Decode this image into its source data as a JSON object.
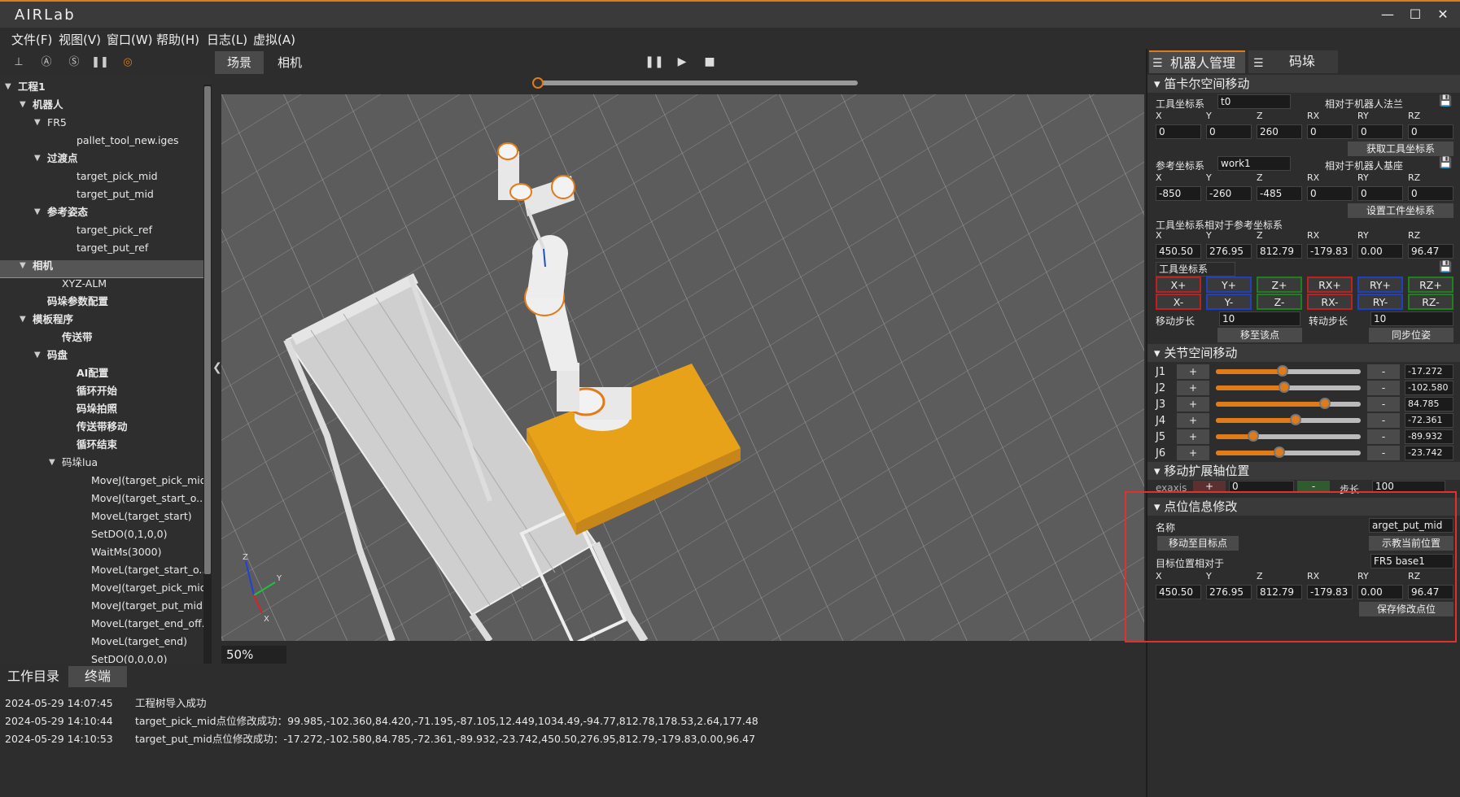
{
  "app": {
    "title": "AIRLab"
  },
  "menu": [
    "文件(F)",
    "视图(V)",
    "窗口(W)",
    "帮助(H)",
    "日志(L)",
    "虚拟(A)"
  ],
  "toolbar_icons": [
    "axis-icon",
    "a-circle-icon",
    "s-circle-icon",
    "pause-bars-icon",
    "target-icon"
  ],
  "view_tabs": [
    "场景",
    "相机"
  ],
  "zoom": "50%",
  "tree": [
    {
      "label": "工程1",
      "bold": true,
      "level": 0,
      "expanded": true
    },
    {
      "label": "机器人",
      "bold": true,
      "level": 1,
      "expanded": true
    },
    {
      "label": "FR5",
      "bold": false,
      "level": 2,
      "expanded": true
    },
    {
      "label": "pallet_tool_new.iges",
      "bold": false,
      "level": 4
    },
    {
      "label": "过渡点",
      "bold": true,
      "level": 2,
      "expanded": true
    },
    {
      "label": "target_pick_mid",
      "bold": false,
      "level": 4
    },
    {
      "label": "target_put_mid",
      "bold": false,
      "level": 4,
      "selected": true
    },
    {
      "label": "参考姿态",
      "bold": true,
      "level": 2,
      "expanded": true
    },
    {
      "label": "target_pick_ref",
      "bold": false,
      "level": 4
    },
    {
      "label": "target_put_ref",
      "bold": false,
      "level": 4
    },
    {
      "label": "相机",
      "bold": true,
      "level": 1,
      "expanded": true
    },
    {
      "label": "XYZ-ALM",
      "bold": false,
      "level": 3
    },
    {
      "label": "码垛参数配置",
      "bold": true,
      "level": 2
    },
    {
      "label": "模板程序",
      "bold": true,
      "level": 1,
      "expanded": true
    },
    {
      "label": "传送带",
      "bold": true,
      "level": 3
    },
    {
      "label": "码盘",
      "bold": true,
      "level": 2,
      "expanded": true
    },
    {
      "label": "AI配置",
      "bold": true,
      "level": 4
    },
    {
      "label": "循环开始",
      "bold": true,
      "level": 4
    },
    {
      "label": "码垛拍照",
      "bold": true,
      "level": 4
    },
    {
      "label": "传送带移动",
      "bold": true,
      "level": 4
    },
    {
      "label": "循环结束",
      "bold": true,
      "level": 4
    },
    {
      "label": "码垛lua",
      "bold": false,
      "level": 3,
      "expanded": true
    },
    {
      "label": "MoveJ(target_pick_mid)",
      "bold": false,
      "level": 5
    },
    {
      "label": "MoveJ(target_start_o...",
      "bold": false,
      "level": 5
    },
    {
      "label": "MoveL(target_start)",
      "bold": false,
      "level": 5
    },
    {
      "label": "SetDO(0,1,0,0)",
      "bold": false,
      "level": 5
    },
    {
      "label": "WaitMs(3000)",
      "bold": false,
      "level": 5
    },
    {
      "label": "MoveL(target_start_o...",
      "bold": false,
      "level": 5
    },
    {
      "label": "MoveJ(target_pick_mid)",
      "bold": false,
      "level": 5
    },
    {
      "label": "MoveJ(target_put_mid)",
      "bold": false,
      "level": 5
    },
    {
      "label": "MoveL(target_end_off...",
      "bold": false,
      "level": 5
    },
    {
      "label": "MoveL(target_end)",
      "bold": false,
      "level": 5
    },
    {
      "label": "SetDO(0,0,0,0)",
      "bold": false,
      "level": 5
    }
  ],
  "bottom_tabs": [
    "工作目录",
    "终端"
  ],
  "logs": [
    {
      "time": "2024-05-29 14:07:45",
      "msg": "工程树导入成功"
    },
    {
      "time": "2024-05-29 14:10:44",
      "msg": "target_pick_mid点位修改成功：99.985,-102.360,84.420,-71.195,-87.105,12.449,1034.49,-94.77,812.78,178.53,2.64,177.48"
    },
    {
      "time": "2024-05-29 14:10:53",
      "msg": "target_put_mid点位修改成功：-17.272,-102.580,84.785,-72.361,-89.932,-23.742,450.50,276.95,812.79,-179.83,0.00,96.47"
    }
  ],
  "right_tabs": [
    "机器人管理",
    "码垛"
  ],
  "axes_labels": [
    "X",
    "Y",
    "Z",
    "RX",
    "RY",
    "RZ"
  ],
  "cartesian": {
    "title": "笛卡尔空间移动",
    "tool_label": "工具坐标系",
    "tool_value": "t0",
    "tool_relative": "相对于机器人法兰",
    "tool_values": [
      "0",
      "0",
      "260",
      "0",
      "0",
      "0"
    ],
    "get_tool_btn": "获取工具坐标系",
    "ref_label": "参考坐标系",
    "ref_value": "work1",
    "ref_relative": "相对于机器人基座",
    "ref_values": [
      "-850",
      "-260",
      "-485",
      "0",
      "0",
      "0"
    ],
    "set_work_btn": "设置工件坐标系",
    "tool_rel_ref_label": "工具坐标系相对于参考坐标系",
    "tool_rel_ref_values": [
      "450.50",
      "276.95",
      "812.79",
      "-179.83",
      "0.00",
      "96.47"
    ],
    "jog_frame": "工具坐标系",
    "jog_plus": [
      "X+",
      "Y+",
      "Z+",
      "RX+",
      "RY+",
      "RZ+"
    ],
    "jog_minus": [
      "X-",
      "Y-",
      "Z-",
      "RX-",
      "RY-",
      "RZ-"
    ],
    "move_step_label": "移动步长",
    "move_step": "10",
    "rot_step_label": "转动步长",
    "rot_step": "10",
    "move_to_btn": "移至该点",
    "sync_btn": "同步位姿"
  },
  "joint": {
    "title": "关节空间移动",
    "joints": [
      {
        "name": "J1",
        "value": "-17.272",
        "level": 0.46
      },
      {
        "name": "J2",
        "value": "-102.580",
        "level": 0.47
      },
      {
        "name": "J3",
        "value": "84.785",
        "level": 0.75
      },
      {
        "name": "J4",
        "value": "-72.361",
        "level": 0.55
      },
      {
        "name": "J5",
        "value": "-89.932",
        "level": 0.26
      },
      {
        "name": "J6",
        "value": "-23.742",
        "level": 0.44
      }
    ],
    "plus": "+",
    "minus": "-"
  },
  "ext_axis": {
    "title": "移动扩展轴位置",
    "label": "exaxis",
    "plus": "+",
    "value": "0",
    "minus": "-",
    "step_label": "步长",
    "step": "100"
  },
  "point_edit": {
    "title": "点位信息修改",
    "name_label": "名称",
    "name_value": "arget_put_mid",
    "move_target_btn": "移动至目标点",
    "teach_btn": "示教当前位置",
    "target_rel_label": "目标位置相对于",
    "target_rel_value": "FR5 base1",
    "values": [
      "450.50",
      "276.95",
      "812.79",
      "-179.83",
      "0.00",
      "96.47"
    ],
    "save_btn": "保存修改点位"
  },
  "colors": {
    "accent": "#e07b1a",
    "highlight_box": "#e03030",
    "floor": "#5c5c5c",
    "pallet": "#e8a21a"
  }
}
